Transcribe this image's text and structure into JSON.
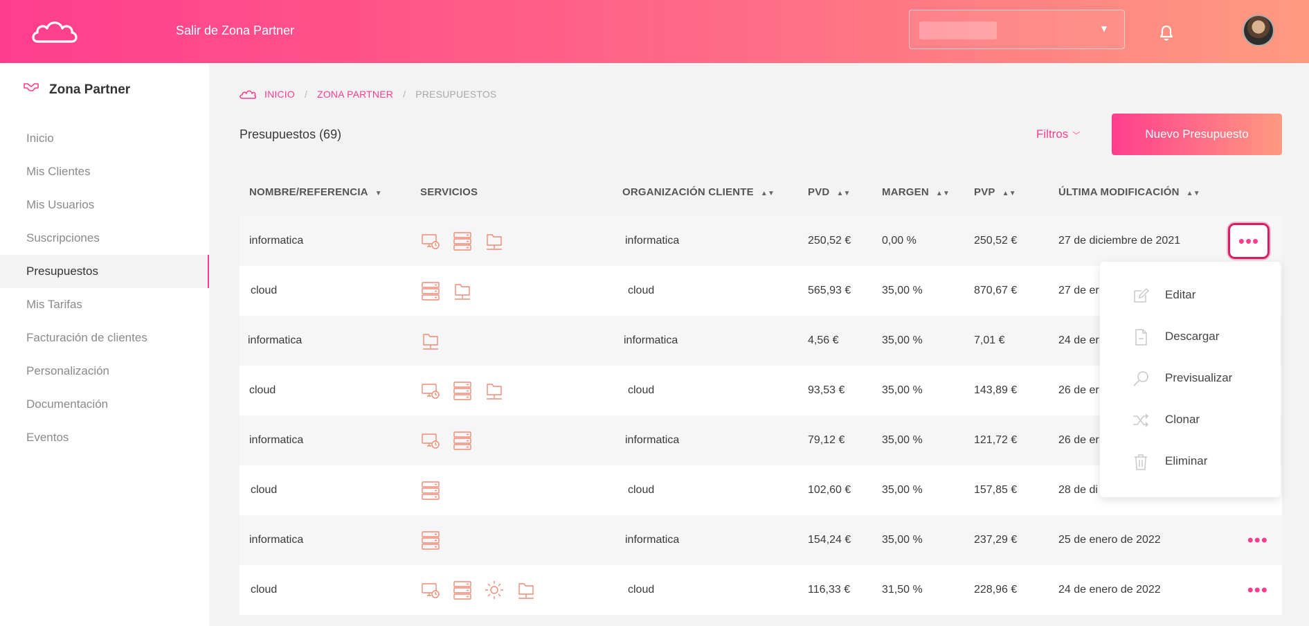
{
  "header": {
    "exit_label": "Salir de Zona Partner"
  },
  "sidebar": {
    "title": "Zona Partner",
    "items": [
      {
        "label": "Inicio"
      },
      {
        "label": "Mis Clientes"
      },
      {
        "label": "Mis Usuarios"
      },
      {
        "label": "Suscripciones"
      },
      {
        "label": "Presupuestos"
      },
      {
        "label": "Mis Tarifas"
      },
      {
        "label": "Facturación de clientes"
      },
      {
        "label": "Personalización"
      },
      {
        "label": "Documentación"
      },
      {
        "label": "Eventos"
      }
    ],
    "active_index": 4
  },
  "breadcrumb": {
    "items": [
      "INICIO",
      "ZONA PARTNER",
      "PRESUPUESTOS"
    ],
    "separator": "/"
  },
  "page": {
    "title": "Presupuestos (69)",
    "filters_label": "Filtros",
    "new_button_label": "Nuevo Presupuesto"
  },
  "table": {
    "columns": [
      "NOMBRE/REFERENCIA",
      "SERVICIOS",
      "ORGANIZACIÓN CLIENTE",
      "PVD",
      "MARGEN",
      "PVP",
      "ÚLTIMA MODIFICACIÓN"
    ],
    "rows": [
      {
        "name": "informatica",
        "services": [
          "desktop-icon",
          "server-icon",
          "folder-network-icon"
        ],
        "org": "informatica",
        "pvd": "250,52 €",
        "margen": "0,00 %",
        "pvp": "250,52 €",
        "date": "27 de diciembre de 2021"
      },
      {
        "name": "cloud",
        "services": [
          "server-icon",
          "folder-network-icon"
        ],
        "org": "cloud",
        "pvd": "565,93 €",
        "margen": "35,00 %",
        "pvp": "870,67 €",
        "date": "27 de er"
      },
      {
        "name": "informatica",
        "services": [
          "folder-network-icon"
        ],
        "org": "informatica",
        "pvd": "4,56 €",
        "margen": "35,00 %",
        "pvp": "7,01 €",
        "date": "24 de er"
      },
      {
        "name": "cloud",
        "services": [
          "desktop-icon",
          "server-icon",
          "folder-network-icon"
        ],
        "org": "cloud",
        "pvd": "93,53 €",
        "margen": "35,00 %",
        "pvp": "143,89 €",
        "date": "26 de er"
      },
      {
        "name": "informatica",
        "services": [
          "desktop-icon",
          "server-icon"
        ],
        "org": "informatica",
        "pvd": "79,12 €",
        "margen": "35,00 %",
        "pvp": "121,72 €",
        "date": "26 de er"
      },
      {
        "name": "cloud",
        "services": [
          "server-icon"
        ],
        "org": "cloud",
        "pvd": "102,60 €",
        "margen": "35,00 %",
        "pvp": "157,85 €",
        "date": "28 de di"
      },
      {
        "name": "informatica",
        "services": [
          "server-icon"
        ],
        "org": "informatica",
        "pvd": "154,24 €",
        "margen": "35,00 %",
        "pvp": "237,29 €",
        "date": "25 de enero de 2022"
      },
      {
        "name": "cloud",
        "services": [
          "desktop-icon",
          "server-icon",
          "gear-icon",
          "folder-network-icon"
        ],
        "org": "cloud",
        "pvd": "116,33 €",
        "margen": "31,50 %",
        "pvp": "228,96 €",
        "date": "24 de enero de 2022"
      }
    ],
    "more_glyph": "•••"
  },
  "menu": {
    "items": [
      {
        "label": "Editar",
        "icon": "edit-icon"
      },
      {
        "label": "Descargar",
        "icon": "file-icon"
      },
      {
        "label": "Previsualizar",
        "icon": "search-icon"
      },
      {
        "label": "Clonar",
        "icon": "shuffle-icon"
      },
      {
        "label": "Eliminar",
        "icon": "trash-icon"
      }
    ]
  },
  "colors": {
    "accent": "#ff3d8d",
    "accent_end": "#ff9a80",
    "service_icon": "#f08a74"
  }
}
